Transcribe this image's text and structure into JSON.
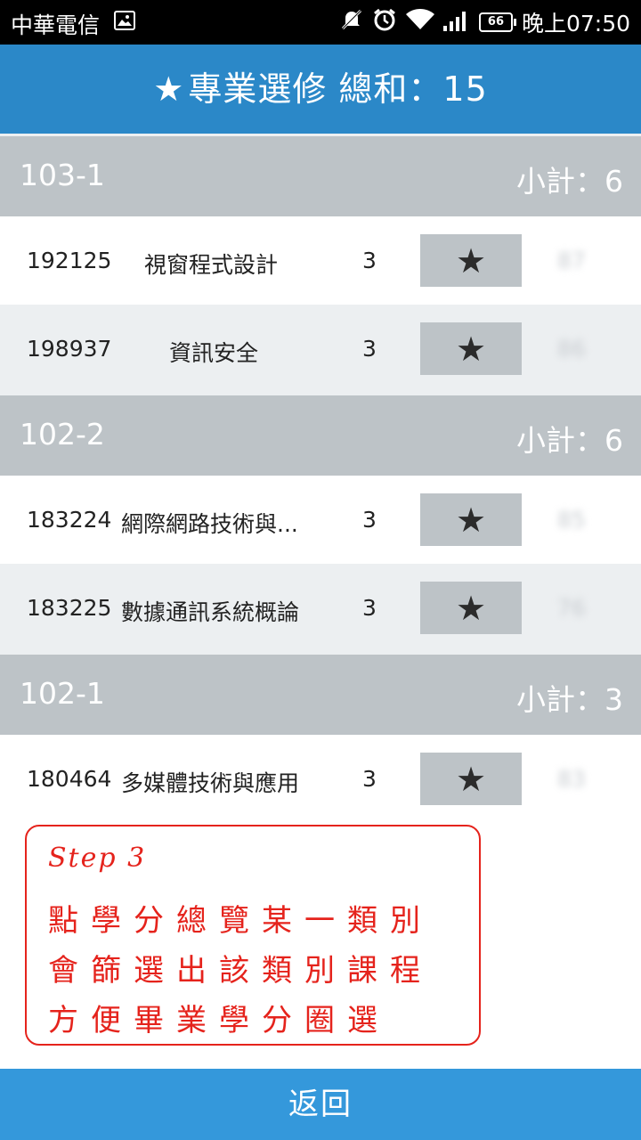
{
  "status_bar": {
    "carrier": "中華電信",
    "battery": "66",
    "time": "晚上07:50",
    "icons": [
      "image-icon",
      "mute-icon",
      "alarm-icon",
      "wifi-icon",
      "signal-icon",
      "battery-icon"
    ]
  },
  "header": {
    "star": "★",
    "title": "專業選修 總和：15"
  },
  "groups": [
    {
      "semester": "103-1",
      "subtotal": "小計：6",
      "courses": [
        {
          "code": "192125",
          "name": "視窗程式設計",
          "credit": "3",
          "star": "★",
          "score": "87"
        },
        {
          "code": "198937",
          "name": "資訊安全",
          "credit": "3",
          "star": "★",
          "score": "86"
        }
      ]
    },
    {
      "semester": "102-2",
      "subtotal": "小計：6",
      "courses": [
        {
          "code": "183224",
          "name": "網際網路技術與...",
          "credit": "3",
          "star": "★",
          "score": "85"
        },
        {
          "code": "183225",
          "name": "數據通訊系統概論",
          "credit": "3",
          "star": "★",
          "score": "76"
        }
      ]
    },
    {
      "semester": "102-1",
      "subtotal": "小計：3",
      "courses": [
        {
          "code": "180464",
          "name": "多媒體技術與應用",
          "credit": "3",
          "star": "★",
          "score": "83"
        }
      ]
    }
  ],
  "annotation": {
    "step": "Step 3",
    "line1": "點學分總覽某一類別",
    "line2": "會篩選出該類別課程",
    "line3": "方便畢業學分圈選"
  },
  "footer": {
    "back_label": "返回"
  },
  "colors": {
    "title_bar": "#2b88c8",
    "group_header": "#bdc3c7",
    "row_alt": "#eceff1",
    "back_button": "#3498db",
    "annotation": "#e5231c"
  }
}
